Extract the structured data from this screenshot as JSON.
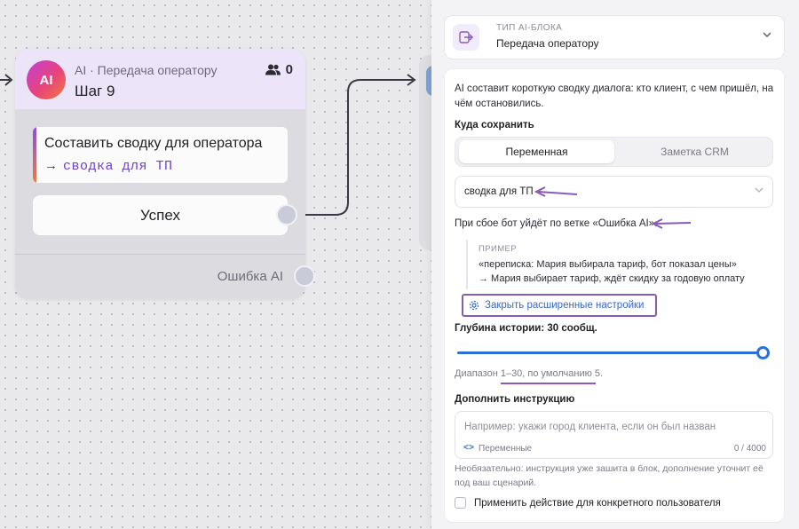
{
  "node": {
    "badge": "AI",
    "type_label": "AI · Передача оператору",
    "step_title": "Шаг 9",
    "users_count": "0",
    "instruction_text": "Составить сводку для оператора",
    "instruction_arrow": "→",
    "instruction_variable": "сводка для ТП",
    "success_label": "Успех",
    "error_label": "Ошибка AI"
  },
  "panel": {
    "type_caption": "ТИП AI-БЛОКА",
    "type_value": "Передача оператору",
    "description": "AI составит короткую сводку диалога: кто клиент, с чем пришёл, на чём остановились.",
    "save_label": "Куда сохранить",
    "tabs": [
      {
        "label": "Переменная",
        "active": true
      },
      {
        "label": "Заметка CRM",
        "active": false
      }
    ],
    "variable_value": "сводка для ТП",
    "fail_note": "При сбое бот уйдёт по ветке «Ошибка AI».",
    "example_caption": "ПРИМЕР",
    "example_line1": "«переписка: Мария выбирала тариф, бот показал цены»",
    "example_line2": "→ Мария выбирает тариф, ждёт скидку за годовую оплату",
    "advanced_button": "Закрыть расширенные настройки",
    "depth_label": "Глубина истории: 30 сообщ.",
    "depth_value": 30,
    "depth_min": 1,
    "depth_max": 30,
    "range_hint": "Диапазон 1–30, по умолчанию 5.",
    "extra_label": "Дополнить инструкцию",
    "extra_placeholder": "Например: укажи город клиента, если он был назван",
    "variables_code": "<>",
    "variables_label": "Переменные",
    "char_count": "0 / 4000",
    "hint": "Необязательно: инструкция уже зашита в блок, дополнение уточнит её под ваш сценарий.",
    "checkbox_label": "Применить действие для конкретного пользователя"
  },
  "colors": {
    "accent": "#2e6fd8",
    "annotation": "#8a5ab8",
    "variable": "#6d3fd6"
  }
}
